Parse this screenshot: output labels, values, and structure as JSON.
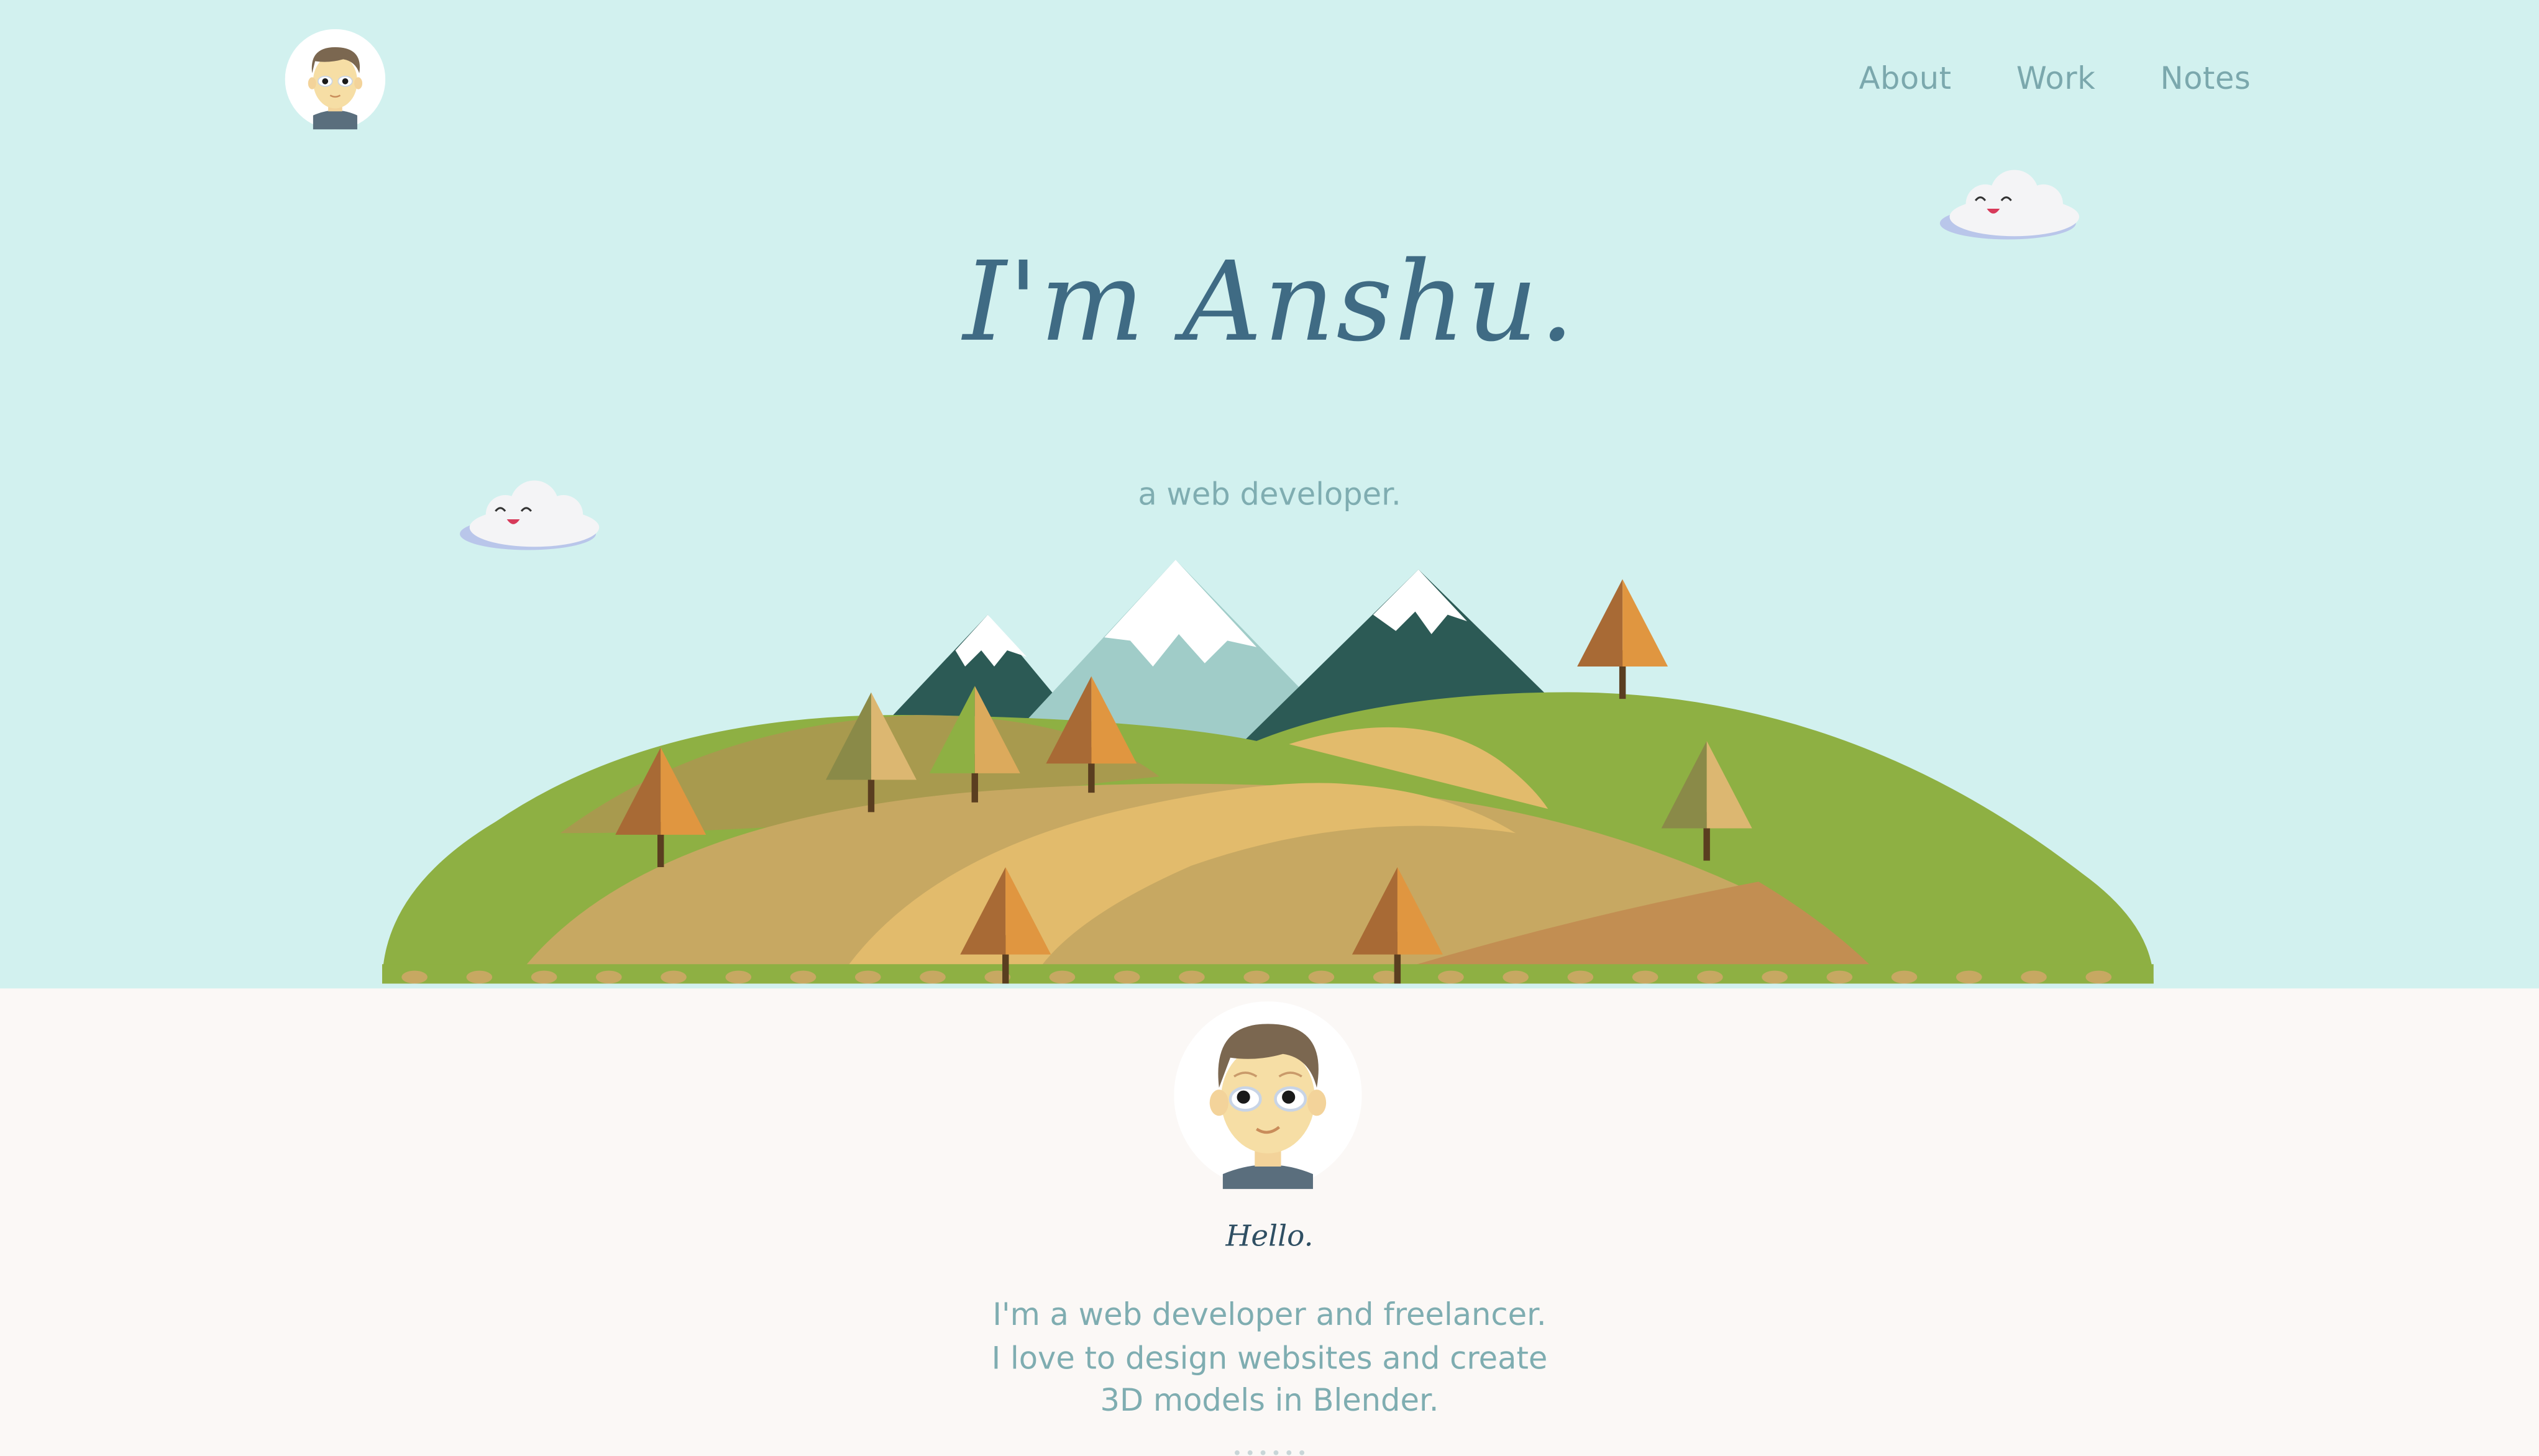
{
  "nav": {
    "items": [
      {
        "label": "About"
      },
      {
        "label": "Work"
      },
      {
        "label": "Notes"
      }
    ]
  },
  "hero": {
    "title": "I'm Anshu.",
    "subtitle": "a web developer."
  },
  "about": {
    "greeting": "Hello.",
    "intro_lines": [
      "I'm a web developer and freelancer.",
      "I love to design websites and create",
      "3D models in Blender."
    ]
  },
  "colors": {
    "sky": "#d2f1ef",
    "page_background": "#fbf8f6",
    "title": "#3f6b84",
    "muted_text": "#7fadb1",
    "greeting": "#2f4f63",
    "hill_green": "#8eb043",
    "path_sand": "#e2bb6c"
  },
  "icons": [
    "avatar-icon",
    "cloud-icon",
    "mountain-icon",
    "tree-icon"
  ]
}
